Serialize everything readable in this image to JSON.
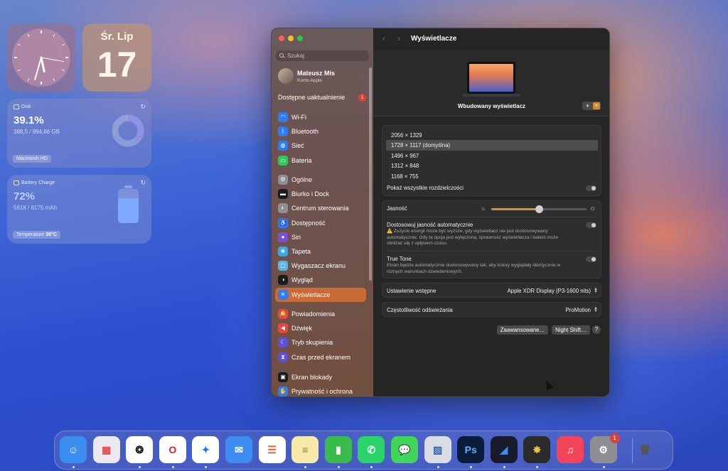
{
  "widgets": {
    "clock": {
      "hour_angle": 168,
      "minute_angle": 196
    },
    "date": {
      "day": "Śr. Lip",
      "number": "17"
    },
    "disk": {
      "label": "Disk",
      "percent": "39.1%",
      "detail": "388,5 / 994,66 GB",
      "volume": "Macintosh HD",
      "used_fraction": 0.391
    },
    "battery": {
      "label": "Battery Charge",
      "percent": "72%",
      "detail": "5618 / 8175 mAh",
      "temp_label": "Temperature",
      "temp_value": "30°C",
      "level": 0.72
    }
  },
  "window": {
    "search_placeholder": "Szukaj",
    "account": {
      "name": "Mateusz Mis",
      "subtitle": "Konto Apple"
    },
    "updates": {
      "label": "Dostępne uaktualnienie",
      "count": "1"
    },
    "sidebar": {
      "group1": [
        {
          "label": "Wi-Fi",
          "icon": "wifi-icon",
          "color": "#2f7bf5",
          "glyph": "◠"
        },
        {
          "label": "Bluetooth",
          "icon": "bluetooth-icon",
          "color": "#2f7bf5",
          "glyph": "ᛒ"
        },
        {
          "label": "Sieć",
          "icon": "globe-icon",
          "color": "#2f7bf5",
          "glyph": "◍"
        },
        {
          "label": "Bateria",
          "icon": "battery-icon",
          "color": "#33c759",
          "glyph": "▭"
        }
      ],
      "group2": [
        {
          "label": "Ogólne",
          "icon": "gear-icon",
          "color": "#8e8e93",
          "glyph": "⚙"
        },
        {
          "label": "Biurko i Dock",
          "icon": "dock-icon",
          "color": "#1c1c1e",
          "glyph": "▬"
        },
        {
          "label": "Centrum sterowania",
          "icon": "control-center-icon",
          "color": "#8e8e93",
          "glyph": "◐"
        },
        {
          "label": "Dostępność",
          "icon": "accessibility-icon",
          "color": "#2f7bf5",
          "glyph": "♿"
        },
        {
          "label": "Siri",
          "icon": "siri-icon",
          "color": "#7a4fd8",
          "glyph": "●"
        },
        {
          "label": "Tapeta",
          "icon": "wallpaper-icon",
          "color": "#38a8e0",
          "glyph": "❀"
        },
        {
          "label": "Wygaszacz ekranu",
          "icon": "screensaver-icon",
          "color": "#5ab5e8",
          "glyph": "▢"
        },
        {
          "label": "Wygląd",
          "icon": "appearance-icon",
          "color": "#1c1c1e",
          "glyph": "◑"
        },
        {
          "label": "Wyświetlacze",
          "icon": "sun-icon",
          "color": "#2f7bf5",
          "glyph": "☀",
          "active": true
        }
      ],
      "group3": [
        {
          "label": "Powiadomienia",
          "icon": "bell-icon",
          "color": "#e8453c",
          "glyph": "🔔"
        },
        {
          "label": "Dźwięk",
          "icon": "speaker-icon",
          "color": "#e8453c",
          "glyph": "◀"
        },
        {
          "label": "Tryb skupienia",
          "icon": "moon-icon",
          "color": "#5b50d6",
          "glyph": "☾"
        },
        {
          "label": "Czas przed ekranem",
          "icon": "hourglass-icon",
          "color": "#5b50d6",
          "glyph": "⧗"
        }
      ],
      "group4": [
        {
          "label": "Ekran blokady",
          "icon": "lock-icon",
          "color": "#1c1c1e",
          "glyph": "▣"
        },
        {
          "label": "Prywatność i ochrona",
          "icon": "hand-icon",
          "color": "#2f7bf5",
          "glyph": "✋"
        }
      ]
    },
    "main": {
      "title": "Wyświetlacze",
      "display_name": "Wbudowany wyświetlacz",
      "resolutions": [
        "2056 × 1329",
        "1728 × 1117 (domyślna)",
        "1496 × 967",
        "1312 × 848",
        "1168 × 755"
      ],
      "selected_resolution": 1,
      "show_all_label": "Pokaż wszystkie rozdzielczości",
      "brightness_label": "Jasność",
      "brightness_level": 0.5,
      "auto_brightness_label": "Dostosowuj jasność automatycznie",
      "auto_brightness_desc": "⚠️ Zużycie energii może być wyższe, gdy wyświetlacz nie jest dostosowywany automatycznie. Gdy ta opcja jest wyłączona, sprawność wyświetlacza i baterii może obniżać się z upływem czasu.",
      "true_tone_label": "True Tone",
      "true_tone_desc": "Ekran będzie automatycznie dostosowywany tak, aby kolory wyglądały identycznie w różnych warunkach oświetleniowych.",
      "preset_label": "Ustawienie wstępne",
      "preset_value": "Apple XDR Display (P3-1600 nits)",
      "refresh_label": "Częstotliwość odświeżania",
      "refresh_value": "ProMotion",
      "advanced_button": "Zaawansowane…",
      "nightshift_button": "Night Shift…",
      "help": "?"
    }
  },
  "dock": [
    {
      "name": "finder",
      "bg": "#3c8df0",
      "glyph": "☺",
      "running": true
    },
    {
      "name": "launchpad",
      "bg": "#e9e9ef",
      "glyph": "▦",
      "fg": "#e05050"
    },
    {
      "name": "chatgpt",
      "bg": "#ffffff",
      "glyph": "❂",
      "fg": "#111",
      "running": true
    },
    {
      "name": "opera",
      "bg": "#ffffff",
      "glyph": "O",
      "fg": "#e11d2a",
      "running": true
    },
    {
      "name": "safari",
      "bg": "#ffffff",
      "glyph": "✦",
      "fg": "#1a7cf0",
      "running": true
    },
    {
      "name": "mail",
      "bg": "#3d8cf1",
      "glyph": "✉"
    },
    {
      "name": "reminders",
      "bg": "#ffffff",
      "glyph": "☰",
      "fg": "#e06030"
    },
    {
      "name": "notes",
      "bg": "#f8e9a8",
      "glyph": "≡",
      "fg": "#8a7a3a",
      "running": true
    },
    {
      "name": "numbers",
      "bg": "#3bbb4c",
      "glyph": "▮",
      "running": true
    },
    {
      "name": "whatsapp",
      "bg": "#2bd46b",
      "glyph": "✆",
      "running": true
    },
    {
      "name": "messages",
      "bg": "#3fd65a",
      "glyph": "💬"
    },
    {
      "name": "preview",
      "bg": "#d9dee6",
      "glyph": "▨",
      "fg": "#3a62b0",
      "running": true
    },
    {
      "name": "photoshop",
      "bg": "#0b1c3a",
      "glyph": "Ps",
      "fg": "#4fb6ff",
      "running": true
    },
    {
      "name": "voice-app",
      "bg": "#1a1a2e",
      "glyph": "◢",
      "fg": "#3a8af5",
      "running": true
    },
    {
      "name": "final-cut",
      "bg": "#2b2b2b",
      "glyph": "✸",
      "fg": "#f0c040",
      "running": true
    },
    {
      "name": "music",
      "bg": "#f24559",
      "glyph": "♫"
    },
    {
      "name": "system-settings",
      "bg": "#8e8e93",
      "glyph": "⚙",
      "running": true,
      "badge": "1"
    },
    {
      "name": "trash",
      "bg": "transparent",
      "glyph": "🗑",
      "fg": "#555"
    }
  ]
}
